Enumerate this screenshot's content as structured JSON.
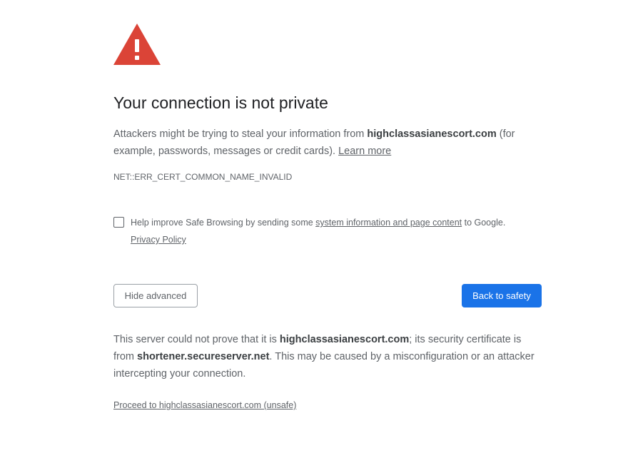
{
  "page": {
    "title": "Your connection is not private",
    "explanation": {
      "prefix": "Attackers might be trying to steal your information from ",
      "domain": "highclassasianescort.com",
      "suffix": " (for example, passwords, messages or credit cards). ",
      "learn_more": "Learn more"
    },
    "error_code": "NET::ERR_CERT_COMMON_NAME_INVALID",
    "safe_browsing": {
      "checked": false,
      "prefix": "Help improve Safe Browsing by sending some ",
      "link": "system information and page content",
      "suffix": " to Google.",
      "privacy_policy": "Privacy Policy"
    },
    "buttons": {
      "hide_advanced": "Hide advanced",
      "back_to_safety": "Back to safety"
    },
    "details": {
      "part1": "This server could not prove that it is ",
      "domain": "highclassasianescort.com",
      "part2": "; its security certificate is from ",
      "issuer": "shortener.secureserver.net",
      "part3": ". This may be caused by a misconfiguration or an attacker intercepting your connection."
    },
    "proceed_link": "Proceed to highclassasianescort.com (unsafe)"
  },
  "colors": {
    "warning_red": "#db4437",
    "primary_blue": "#1a73e8",
    "title_text": "#202124",
    "body_text": "#5f6368"
  },
  "icons": {
    "warning": "warning-triangle-icon"
  }
}
